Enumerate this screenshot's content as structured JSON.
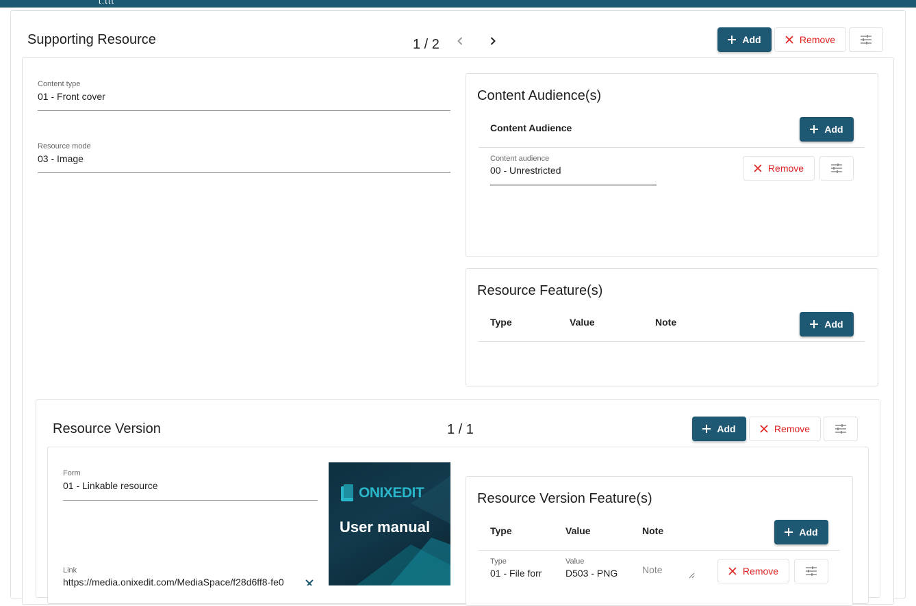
{
  "topbar": {
    "logo_fragment": "ɩ.ɩɩɩ"
  },
  "supporting_resource": {
    "title": "Supporting Resource",
    "pager": "1 / 2",
    "add_label": "Add",
    "remove_label": "Remove",
    "content_type": {
      "label": "Content type",
      "value": "01 - Front cover"
    },
    "resource_mode": {
      "label": "Resource mode",
      "value": "03 - Image"
    }
  },
  "content_audiences": {
    "title": "Content Audience(s)",
    "header": "Content Audience",
    "add_label": "Add",
    "remove_label": "Remove",
    "item": {
      "label": "Content audience",
      "value": "00 - Unrestricted"
    }
  },
  "resource_features": {
    "title": "Resource Feature(s)",
    "columns": [
      "Type",
      "Value",
      "Note"
    ],
    "add_label": "Add"
  },
  "resource_version": {
    "title": "Resource Version",
    "pager": "1 / 1",
    "add_label": "Add",
    "remove_label": "Remove",
    "form": {
      "label": "Form",
      "value": "01 - Linkable resource"
    },
    "link": {
      "label": "Link",
      "value": "https://media.onixedit.com/MediaSpace/f28d6ff8-fe0"
    },
    "cover": {
      "brand": "ONIXEDIT",
      "title": "User manual"
    }
  },
  "resource_version_features": {
    "title": "Resource Version Feature(s)",
    "columns": [
      "Type",
      "Value",
      "Note"
    ],
    "add_label": "Add",
    "remove_label": "Remove",
    "row": {
      "type_label": "Type",
      "type_value": "01 - File forr",
      "value_label": "Value",
      "value_value": "D503 - PNG",
      "note_placeholder": "Note"
    }
  },
  "colors": {
    "primary": "#1e5872",
    "danger": "#e01f1f",
    "accent": "#29b6c8"
  },
  "icons": [
    "plus-icon",
    "close-icon",
    "tune-icon",
    "chevron-left-icon",
    "chevron-right-icon",
    "clear-icon",
    "book-icon"
  ]
}
